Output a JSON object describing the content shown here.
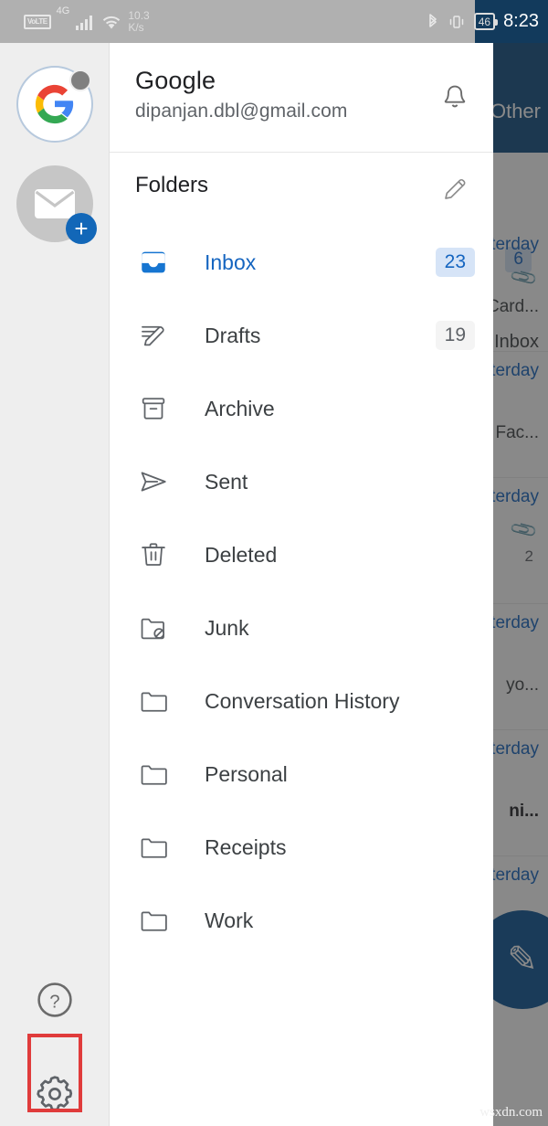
{
  "statusbar": {
    "volte_label": "VoLTE",
    "network_gen": "4G",
    "speed": "10.3\nK/s",
    "speed_value": "10.3",
    "speed_unit": "K/s",
    "battery": "46",
    "time": "8:23",
    "icons": [
      "volte-icon",
      "signal-bars-icon",
      "wifi-icon",
      "bluetooth-icon",
      "vibrate-icon",
      "battery-icon"
    ]
  },
  "rail": {
    "accounts": [
      {
        "name": "google-account-avatar",
        "letter": "G",
        "status": "offline-dot"
      },
      {
        "name": "add-account-avatar",
        "badge": "+"
      }
    ],
    "help_label": "?",
    "settings_label": "settings",
    "highlight_color": "#e03b3b"
  },
  "account": {
    "name": "Google",
    "email": "dipanjan.dbl@gmail.com",
    "notification_icon": "bell-icon"
  },
  "folders_section": {
    "title": "Folders",
    "edit_icon": "pencil-icon",
    "items": [
      {
        "label": "Inbox",
        "icon": "inbox-icon",
        "badge": "23",
        "selected": true
      },
      {
        "label": "Drafts",
        "icon": "drafts-pencil-icon",
        "badge": "19",
        "selected": false
      },
      {
        "label": "Archive",
        "icon": "archive-box-icon",
        "badge": "",
        "selected": false
      },
      {
        "label": "Sent",
        "icon": "send-plane-icon",
        "badge": "",
        "selected": false
      },
      {
        "label": "Deleted",
        "icon": "trash-icon",
        "badge": "",
        "selected": false
      },
      {
        "label": "Junk",
        "icon": "folder-block-icon",
        "badge": "",
        "selected": false
      },
      {
        "label": "Conversation History",
        "icon": "folder-icon",
        "badge": "",
        "selected": false
      },
      {
        "label": "Personal",
        "icon": "folder-icon",
        "badge": "",
        "selected": false
      },
      {
        "label": "Receipts",
        "icon": "folder-icon",
        "badge": "",
        "selected": false
      },
      {
        "label": "Work",
        "icon": "folder-icon",
        "badge": "",
        "selected": false
      }
    ]
  },
  "background": {
    "appbar_title": "Other",
    "tab_label": "Inbox",
    "tab_badge": "6",
    "fab_icon": "compose-pencil-icon",
    "rows": [
      {
        "date": "Yesterday",
        "snippet": "Card...",
        "attachment": true,
        "count": ""
      },
      {
        "date": "Yesterday",
        "snippet": "Fac...",
        "attachment": false,
        "count": ""
      },
      {
        "date": "Yesterday",
        "snippet": "",
        "attachment": true,
        "count": "2"
      },
      {
        "date": "Yesterday",
        "snippet": "yo...",
        "attachment": false,
        "count": ""
      },
      {
        "date": "Yesterday",
        "snippet": "ni...",
        "attachment": false,
        "count": ""
      },
      {
        "date": "Yesterday",
        "snippet": "",
        "attachment": false,
        "count": ""
      }
    ]
  },
  "watermark": "wsxdn.com",
  "colors": {
    "accent_blue": "#1565c0",
    "appbar_blue": "#0f4c81",
    "badge_blue_bg": "#d6e4f7",
    "rail_bg": "#eeeeee",
    "highlight_red": "#e03b3b"
  }
}
